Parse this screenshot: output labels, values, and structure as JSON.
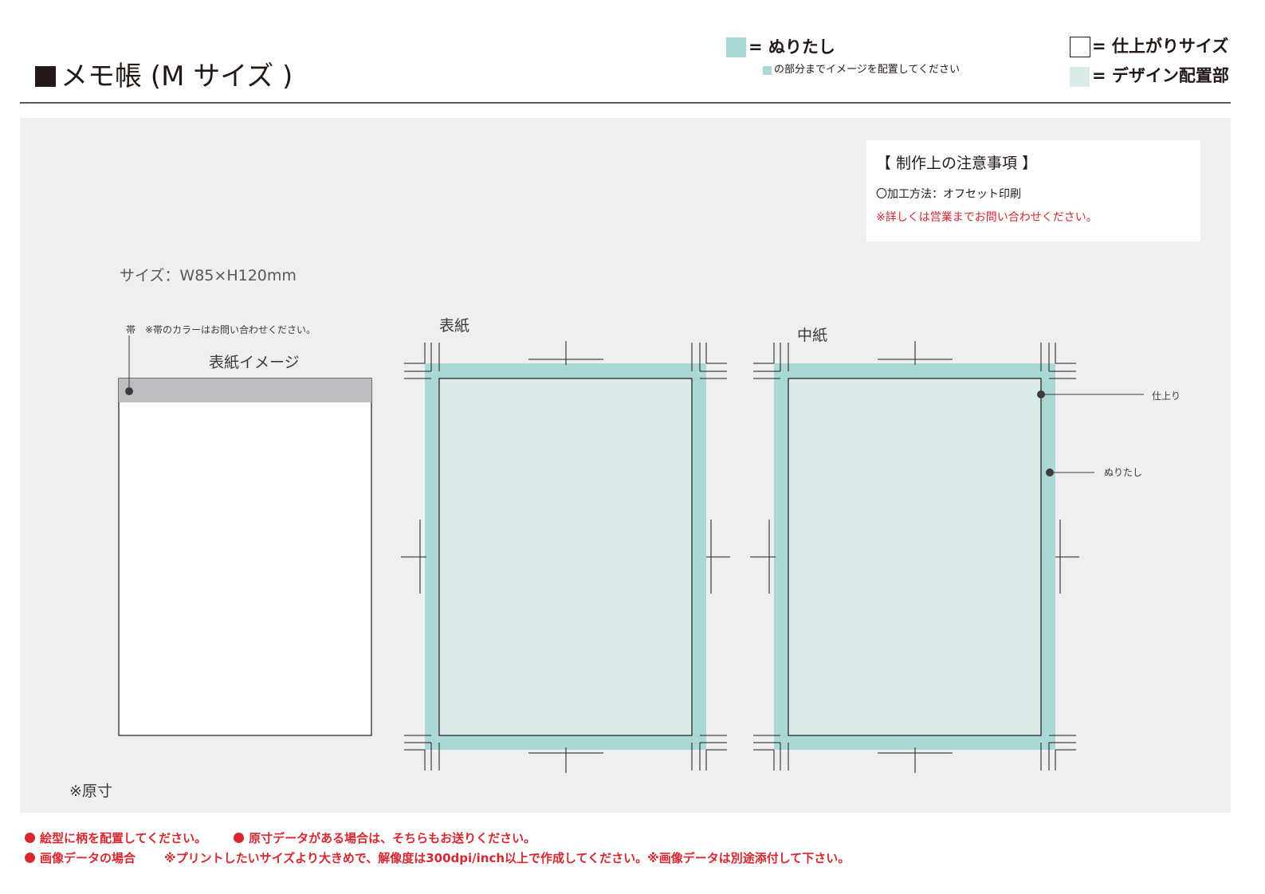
{
  "header": {
    "title": "メモ帳 (M サイズ )"
  },
  "legend": {
    "bleed_label": "= ぬりたし",
    "bleed_sub": "の部分までイメージを配置してください",
    "trim_label": "= 仕上がりサイズ",
    "design_label": "= デザイン配置部"
  },
  "notes": {
    "title": "【 制作上の注意事項 】",
    "line1": "〇加工方法：オフセット印刷",
    "line2": "※詳しくは営業までお問い合わせください。"
  },
  "main": {
    "size_label": "サイズ：W85×H120mm",
    "band_note": "帯　※帯のカラーはお問い合わせください。",
    "cover_image_label": "表紙イメージ",
    "cover_label": "表紙",
    "inner_label": "中紙",
    "trim_annotation": "仕上り",
    "bleed_annotation": "ぬりたし",
    "original_size_note": "※原寸"
  },
  "footer": {
    "note1": "絵型に柄を配置してください。",
    "note2": "原寸データがある場合は、そちらもお送りください。",
    "note3_head": "画像データの場合",
    "note3_body": "※プリントしたいサイズより大きめで、解像度は300dpi/inch以上で作成してください。※画像データは別途添付して下さい。"
  },
  "colors": {
    "bleed": "#a9d8d7",
    "design_area": "#d9ecea",
    "band": "#bcbdc0",
    "panel_bg": "#eeefee",
    "warning": "#d7282f"
  }
}
